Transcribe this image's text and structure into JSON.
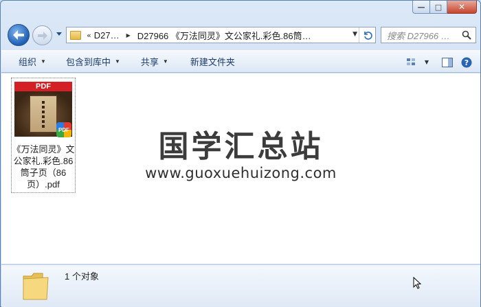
{
  "window": {
    "caption": {
      "minimize_glyph": "—",
      "maximize_glyph": "□",
      "close_glyph": "✕"
    }
  },
  "nav": {
    "back_icon": "back-arrow-icon",
    "forward_icon": "forward-arrow-icon"
  },
  "address": {
    "overflow": "«",
    "crumbs": [
      "D27…",
      "D27966 《万法同灵》文公家礼.彩色.86筒…"
    ]
  },
  "search": {
    "placeholder": "搜索 D27966 …"
  },
  "toolbar": {
    "organize": "组织",
    "include_in_library": "包含到库中",
    "share": "共享",
    "new_folder": "新建文件夹"
  },
  "files": [
    {
      "thumb_label": "PDF",
      "badge_label": "PDF",
      "name": "《万法同灵》文公家礼.彩色.86筒子页（86页）.pdf"
    }
  ],
  "watermark": {
    "title": "国学汇总站",
    "url": "www.guoxuehuizong.com"
  },
  "details": {
    "status": "1 个对象"
  },
  "colors": {
    "accent": "#1f5fb4",
    "pdf_red": "#d41f25"
  }
}
